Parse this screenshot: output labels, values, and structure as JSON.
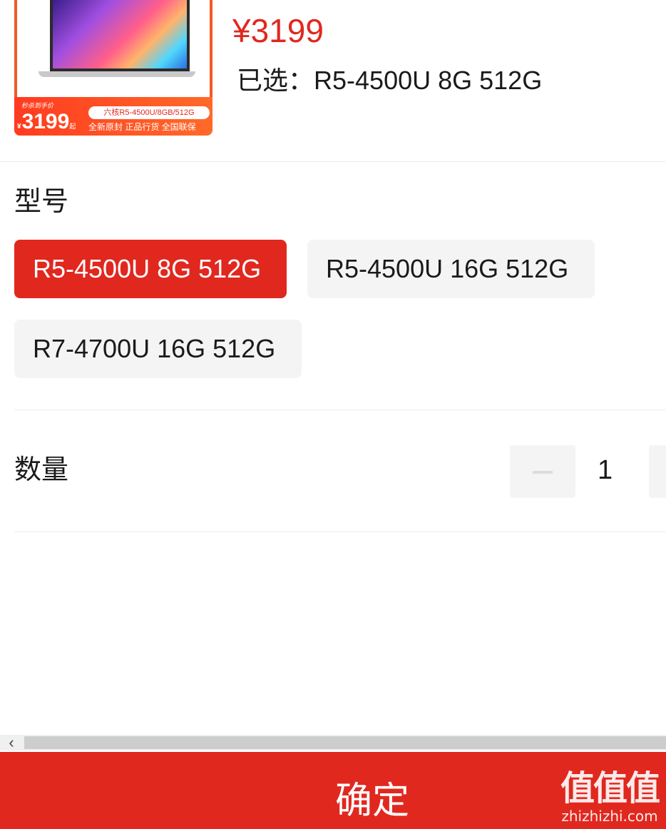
{
  "product": {
    "price": "¥3199",
    "selected_prefix": "已选：",
    "selected_value": "R5-4500U 8G 512G",
    "thumbnail": {
      "tag": "秒杀到手价",
      "yen": "¥",
      "price": "3199",
      "qi": "起",
      "spec": "六核R5-4500U/8GB/512G",
      "slogan": "全新原封 正品行货 全国联保"
    }
  },
  "model": {
    "title": "型号",
    "options": [
      {
        "label": "R5-4500U 8G 512G",
        "active": true
      },
      {
        "label": "R5-4500U 16G 512G",
        "active": false
      },
      {
        "label": "R7-4700U 16G 512G",
        "active": false
      }
    ]
  },
  "quantity": {
    "title": "数量",
    "value": "1"
  },
  "scrollbar": {
    "arrow": "‹"
  },
  "confirm": {
    "label": "确定"
  },
  "watermark": {
    "main": "值值值",
    "sub": "zhizhizhi.com"
  },
  "colors": {
    "accent": "#e0281f",
    "chip_bg": "#f4f4f4"
  }
}
